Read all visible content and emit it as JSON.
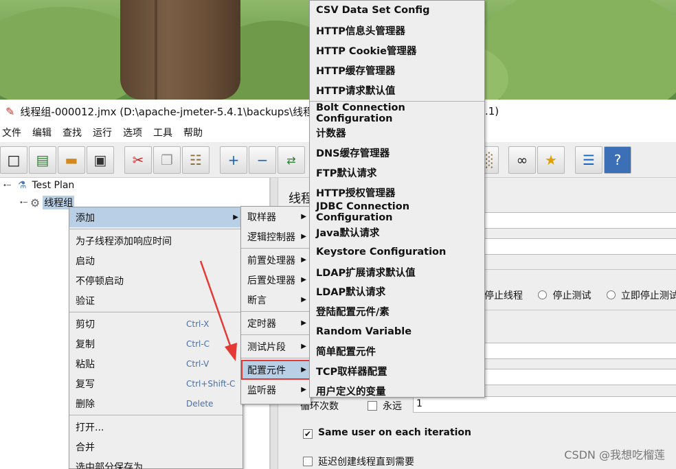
{
  "window": {
    "title": "线程组-000012.jmx (D:\\apache-jmeter-5.4.1\\backups\\线程组",
    "title_tail": ".1)"
  },
  "menubar": [
    "文件",
    "编辑",
    "查找",
    "运行",
    "选项",
    "工具",
    "帮助"
  ],
  "toolbar_icons": [
    "new-icon",
    "templates-icon",
    "open-icon",
    "save-icon",
    "cut-icon",
    "copy-icon",
    "paste-icon",
    "expand-icon",
    "collapse-icon",
    "toggle-icon",
    "broom-icon",
    "binoculars-icon",
    "clear-all-icon",
    "function-helper-icon",
    "help-icon"
  ],
  "tree": {
    "root": "Test Plan",
    "child": "线程组"
  },
  "context_menu": {
    "items": [
      {
        "label": "添加",
        "submenu": true
      },
      {
        "label": "为子线程添加响应时间"
      },
      {
        "label": "启动"
      },
      {
        "label": "不停顿启动"
      },
      {
        "label": "验证"
      },
      {
        "label": "剪切",
        "accel": "Ctrl-X"
      },
      {
        "label": "复制",
        "accel": "Ctrl-C"
      },
      {
        "label": "粘贴",
        "accel": "Ctrl-V"
      },
      {
        "label": "复写",
        "accel": "Ctrl+Shift-C"
      },
      {
        "label": "删除",
        "accel": "Delete"
      },
      {
        "label": "打开..."
      },
      {
        "label": "合并"
      },
      {
        "label": "选中部分保存为..."
      }
    ]
  },
  "add_submenu": {
    "items": [
      "取样器",
      "逻辑控制器",
      "前置处理器",
      "后置处理器",
      "断言",
      "定时器",
      "测试片段",
      "配置元件",
      "监听器"
    ],
    "highlighted": "配置元件"
  },
  "config_submenu": {
    "items": [
      "CSV Data Set Config",
      "HTTP信息头管理器",
      "HTTP Cookie管理器",
      "HTTP缓存管理器",
      "HTTP请求默认值",
      "Bolt Connection Configuration",
      "计数器",
      "DNS缓存管理器",
      "FTP默认请求",
      "HTTP授权管理器",
      "JDBC Connection Configuration",
      "Java默认请求",
      "Keystore Configuration",
      "LDAP扩展请求默认值",
      "LDAP默认请求",
      "登陆配置元件/素",
      "Random Variable",
      "简单配置元件",
      "TCP取样器配置",
      "用户定义的变量"
    ]
  },
  "right_panel": {
    "heading": "线程",
    "radio_labels": [
      "停止线程",
      "停止测试",
      "立即停止测试"
    ],
    "loop_label": "循环次数",
    "forever_label": "永远",
    "loop_value": "1",
    "same_user_label": "Same user on each iteration",
    "delay_label": "延迟创建线程直到需要"
  },
  "watermark": "CSDN @我想吃榴莲",
  "colors": {
    "highlight": "#b8cfe5",
    "annotation_red": "#e53935",
    "accel_text": "#4a6fa5"
  }
}
